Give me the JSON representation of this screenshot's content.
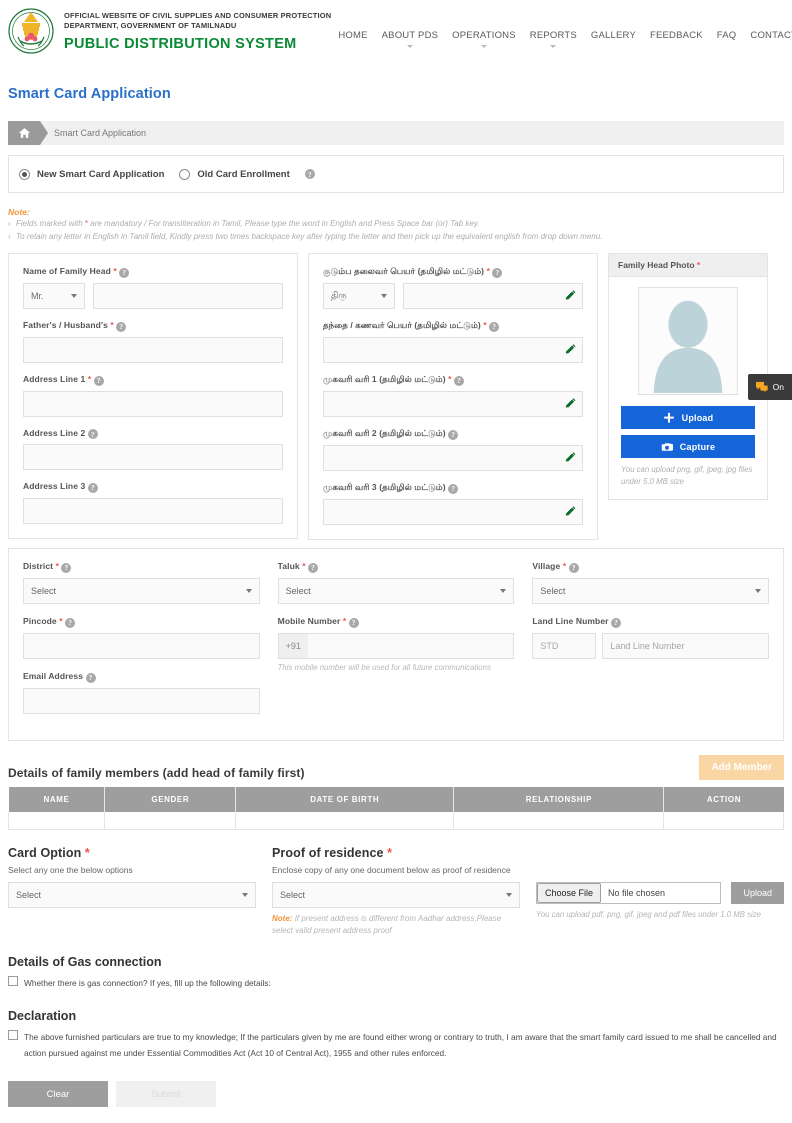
{
  "header": {
    "emblem_icon": "tamilnadu-state-emblem",
    "line1": "OFFICIAL WEBSITE OF CIVIL SUPPLIES AND CONSUMER PROTECTION",
    "line2": "DEPARTMENT, GOVERNMENT OF TAMILNADU",
    "title": "PUBLIC DISTRIBUTION SYSTEM",
    "title_color": "#0a8a34",
    "nav": [
      {
        "label": "HOME",
        "caret": false
      },
      {
        "label": "ABOUT PDS",
        "caret": true
      },
      {
        "label": "OPERATIONS",
        "caret": true
      },
      {
        "label": "REPORTS",
        "caret": true
      },
      {
        "label": "GALLERY",
        "caret": false
      },
      {
        "label": "FEEDBACK",
        "caret": false
      },
      {
        "label": "FAQ",
        "caret": false
      },
      {
        "label": "CONTACT US",
        "caret": false
      }
    ]
  },
  "page_title": "Smart Card Application",
  "page_title_color": "#2a6fc9",
  "breadcrumb": {
    "home_icon": "home-icon",
    "current": "Smart Card Application"
  },
  "application_type": {
    "option_new": "New Smart Card Application",
    "option_old": "Old Card Enrollment",
    "selected": "New Smart Card Application",
    "help_icon": "help-icon"
  },
  "note": {
    "title": "Note:",
    "title_color": "#f0963c",
    "line1_a": "Fields marked with",
    "line1_star": "*",
    "line1_b": "are mandatory  / For transliteration in Tamil, Please type the word in English and Press Space bar (or) Tab key.",
    "line2": "To retain any letter in English in Tamil field, Kindly press two times backspace key after typing the letter and then pick up the equivalent english from drop down menu."
  },
  "english_fields": {
    "name_label": "Name of Family Head",
    "name_title_value": "Mr.",
    "name_value": "",
    "father_label": "Father's / Husband's",
    "father_value": "",
    "addr1_label": "Address Line 1",
    "addr1_value": "",
    "addr2_label": "Address Line 2",
    "addr2_value": "",
    "addr3_label": "Address Line 3",
    "addr3_value": ""
  },
  "tamil_fields": {
    "name_label": "குடும்ப தலைவர் பெயர் (தமிழில் மட்டும்)",
    "name_title_value": "திரு",
    "name_value": "",
    "father_label": "தந்தை / கணவர் பெயர் (தமிழில் மட்டும்)",
    "father_value": "",
    "addr1_label": "முகவரி வரி 1 (தமிழில் மட்டும்)",
    "addr1_value": "",
    "addr2_label": "முகவரி வரி 2 (தமிழில் மட்டும்)",
    "addr2_value": "",
    "addr3_label": "முகவரி வரி 3 (தமிழில் மட்டும்)",
    "addr3_value": "",
    "pencil_icon": "pencil-icon"
  },
  "photo_panel": {
    "heading": "Family Head Photo",
    "avatar_icon": "user-avatar-placeholder-icon",
    "upload_label": "Upload",
    "upload_icon": "plus-icon",
    "capture_label": "Capture",
    "capture_icon": "camera-icon",
    "button_color": "#1565d8",
    "hint": "You can upload png, gif, jpeg, jpg files under 5.0 MB size"
  },
  "chat_tab": {
    "label": "On",
    "icon": "chat-bubbles-icon",
    "icon_color": "#f5a623"
  },
  "location": {
    "district_label": "District",
    "district_value": "Select",
    "taluk_label": "Taluk",
    "taluk_value": "Select",
    "village_label": "Village",
    "village_value": "Select",
    "pincode_label": "Pincode",
    "pincode_value": "",
    "mobile_label": "Mobile Number",
    "mobile_prefix": "+91",
    "mobile_value": "",
    "mobile_hint": "This mobile number will be used for all future communications",
    "landline_label": "Land Line Number",
    "landline_std_placeholder": "STD",
    "landline_placeholder": "Land Line Number",
    "email_label": "Email Address",
    "email_value": ""
  },
  "family_members": {
    "title": "Details of family members (add head of family first)",
    "add_button": "Add Member",
    "add_button_color": "#fbd6a5",
    "columns": [
      "NAME",
      "GENDER",
      "DATE OF BIRTH",
      "RELATIONSHIP",
      "ACTION"
    ],
    "rows": []
  },
  "card_option": {
    "title": "Card Option",
    "subtitle": "Select any one the below options",
    "value": "Select"
  },
  "proof_of_residence": {
    "title": "Proof of residence",
    "subtitle": "Enclose copy of any one document below as proof of residence",
    "value": "Select",
    "note_label": "Note:",
    "note_text": "If present address is different from Aadhar address,Please select valid present address proof"
  },
  "file_upload": {
    "choose_label": "Choose File",
    "file_status": "No file chosen",
    "upload_label": "Upload",
    "hint": "You can upload pdf, png, gif, jpeg and pdf files under 1.0 MB size"
  },
  "gas": {
    "title": "Details of Gas connection",
    "checkbox_label": "Whether there is gas connection? If yes, fill up the following details:",
    "checked": false
  },
  "declaration": {
    "title": "Declaration",
    "text": "The above furnished particulars are true to my knowledge; If the particulars given by me are found either wrong or contrary to truth, I am aware that the smart family card issued to me shall be cancelled and action pursued against me under Essential Commodities Act (Act 10 of Central Act), 1955 and other rules enforced.",
    "checked": false
  },
  "footer": {
    "clear_label": "Clear",
    "submit_label": "Submit"
  }
}
